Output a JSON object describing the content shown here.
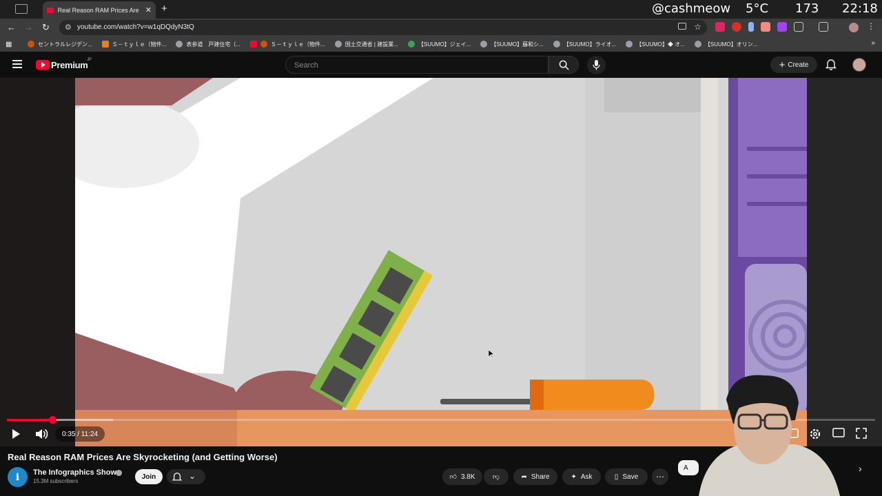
{
  "browser": {
    "tab_title": "Real Reason RAM Prices Are",
    "url": "youtube.com/watch?v=w1qDQdyN3tQ",
    "bookmarks": [
      "セントラルレジデン...",
      "Ｓ－ｔｙｌｅ（物件...",
      "表参道　戸建住宅（...",
      "Ｓ－ｔｙｌｅ（物件...",
      "国土交通省 | 建設業...",
      "【SUUMO】ジェイ...",
      "【SUUMO】藤和シ...",
      "【SUUMO】ライオ...",
      "【SUUMO】◆ オ...",
      "【SUUMO】オリン..."
    ]
  },
  "overlay": {
    "handle": "@cashmeow",
    "temperature": "5°C",
    "count": "173",
    "clock": "22:18"
  },
  "youtube": {
    "logo_text": "Premium",
    "region": "JP",
    "search_placeholder": "Search",
    "create_label": "Create"
  },
  "player": {
    "time": "0:35 / 11:24",
    "progress": 0.052,
    "buffered": 0.122,
    "icons": [
      "play-icon",
      "volume-icon",
      "captions-icon",
      "settings-icon",
      "theater-icon",
      "fullscreen-icon"
    ]
  },
  "video": {
    "title": "Real Reason RAM Prices Are Skyrocketing (and Getting Worse)",
    "channel": "The Infographics Show",
    "channel_initial": "i",
    "subscribers": "15.3M subscribers",
    "join_label": "Join",
    "likes": "3.8K",
    "share_label": "Share",
    "ask_label": "Ask",
    "save_label": "Save",
    "chip_label": "A"
  },
  "colors": {
    "brand_red": "#ff0033",
    "background": "#0f0f0f",
    "pill_bg": "#272727"
  }
}
